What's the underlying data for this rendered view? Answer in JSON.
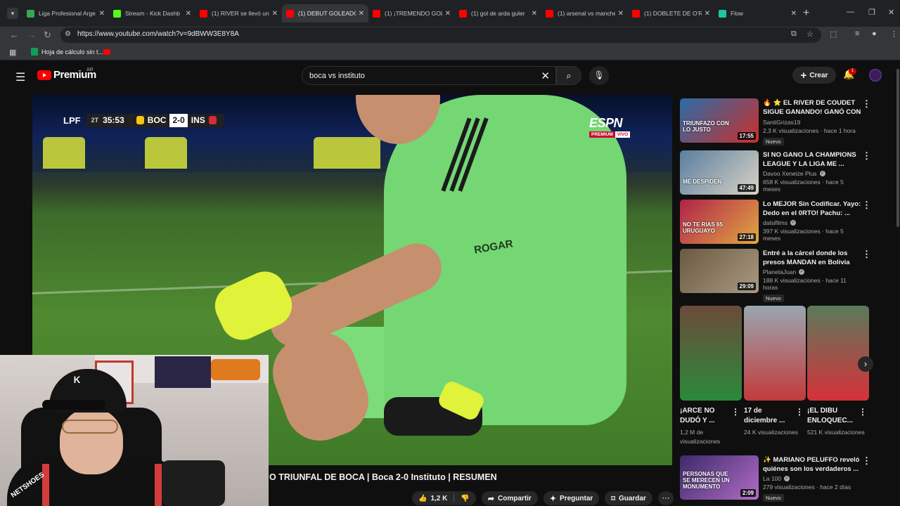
{
  "browser": {
    "tabs": [
      {
        "title": "Liga Profesional Arge",
        "fav": "#34a853",
        "active": false
      },
      {
        "title": "Stream - Kick Dashb",
        "fav": "#53fc18",
        "active": false
      },
      {
        "title": "(1) RIVER se llevó una",
        "fav": "#ff0000",
        "active": false
      },
      {
        "title": "(1) DEBUT GOLEADOR",
        "fav": "#ff0000",
        "active": true
      },
      {
        "title": "(1) ¡TREMENDO GOL",
        "fav": "#ff0000",
        "active": false
      },
      {
        "title": "(1) gol de arda guler",
        "fav": "#ff0000",
        "active": false
      },
      {
        "title": "(1) arsenal vs manche",
        "fav": "#ff0000",
        "active": false
      },
      {
        "title": "(1) DOBLETE DE O'RE",
        "fav": "#ff0000",
        "active": false
      },
      {
        "title": "Flow",
        "fav": "#1ec7a0",
        "active": false
      }
    ],
    "url": "https://www.youtube.com/watch?v=9dBWW3E8Y8A",
    "bookmark": "Hoja de cálculo sin t..."
  },
  "header": {
    "logo": "Premium",
    "country": "AR",
    "search_query": "boca vs instituto",
    "create_label": "Crear",
    "notifications": "1"
  },
  "player": {
    "scorebug": {
      "league": "LPF",
      "half": "2T",
      "clock": "35:53",
      "home": "BOC",
      "score": "2-0",
      "away": "INS"
    },
    "broadcaster": "ESPN",
    "broadcaster_tag1": "PREMIUM",
    "broadcaster_tag2": "VIVO",
    "shirt_sponsor": "ROGAR"
  },
  "video": {
    "title": "O TRIUNFAL DE BOCA | Boca 2-0 Instituto | RESUMEN",
    "likes": "1,2 K",
    "share": "Compartir",
    "ask": "Preguntar",
    "save": "Guardar"
  },
  "recommendations": [
    {
      "title": "🔥 ⭐ EL RIVER DE COUDET SIGUE GANANDO! GANÓ CON ...",
      "channel": "SantiGrizas19",
      "verified": false,
      "meta": "2,3 K visualizaciones · hace 1 hora",
      "badge": "Nuevo",
      "duration": "17:55",
      "thumb_overlay": "TRIUNFAZO CON LO JUSTO"
    },
    {
      "title": "SI NO GANO LA CHAMPIONS LEAGUE Y LA LIGA ME ...",
      "channel": "Davoo Xeneize Plus",
      "verified": true,
      "meta": "658 K visualizaciones · hace 5 meses",
      "badge": "",
      "duration": "47:49",
      "thumb_overlay": "ME DESPIDEN"
    },
    {
      "title": "Lo MEJOR Sin Codificar. Yayo: Dedo en el 0RTO! Pachu: ...",
      "channel": "dalsifilms",
      "verified": true,
      "meta": "397 K visualizaciones · hace 5 meses",
      "badge": "",
      "duration": "27:18",
      "thumb_overlay": "NO TE RIAS 65 URUGUAYO"
    },
    {
      "title": "Entré a la cárcel donde los presos MANDAN en Bolivia",
      "channel": "PlanetaJuan",
      "verified": true,
      "meta": "188 K visualizaciones · hace 11 horas",
      "badge": "Nuevo",
      "duration": "29:09",
      "thumb_overlay": ""
    },
    {
      "title": "✨ MARIANO PELUFFO reveló quiénes son los verdaderos ...",
      "channel": "La 100",
      "verified": true,
      "meta": "279 visualizaciones · hace 2 días",
      "badge": "Nuevo",
      "duration": "2:09",
      "thumb_overlay": "PERSONAS QUE SE MERECEN UN MONUMENTO"
    }
  ],
  "shorts": [
    {
      "title": "¡ARCE NO DUDÓ Y ...",
      "views": "1,2 M de visualizaciones"
    },
    {
      "title": "17 de diciembre ...",
      "views": "24 K visualizaciones"
    },
    {
      "title": "¡EL DIBU ENLOQUEC...",
      "views": "521 K visualizaciones"
    }
  ],
  "webcam": {
    "sponsor": "NETSHOES"
  },
  "colors": {
    "accent": "#ff0000",
    "bg": "#0f0f0f",
    "jersey": "#74d774"
  }
}
